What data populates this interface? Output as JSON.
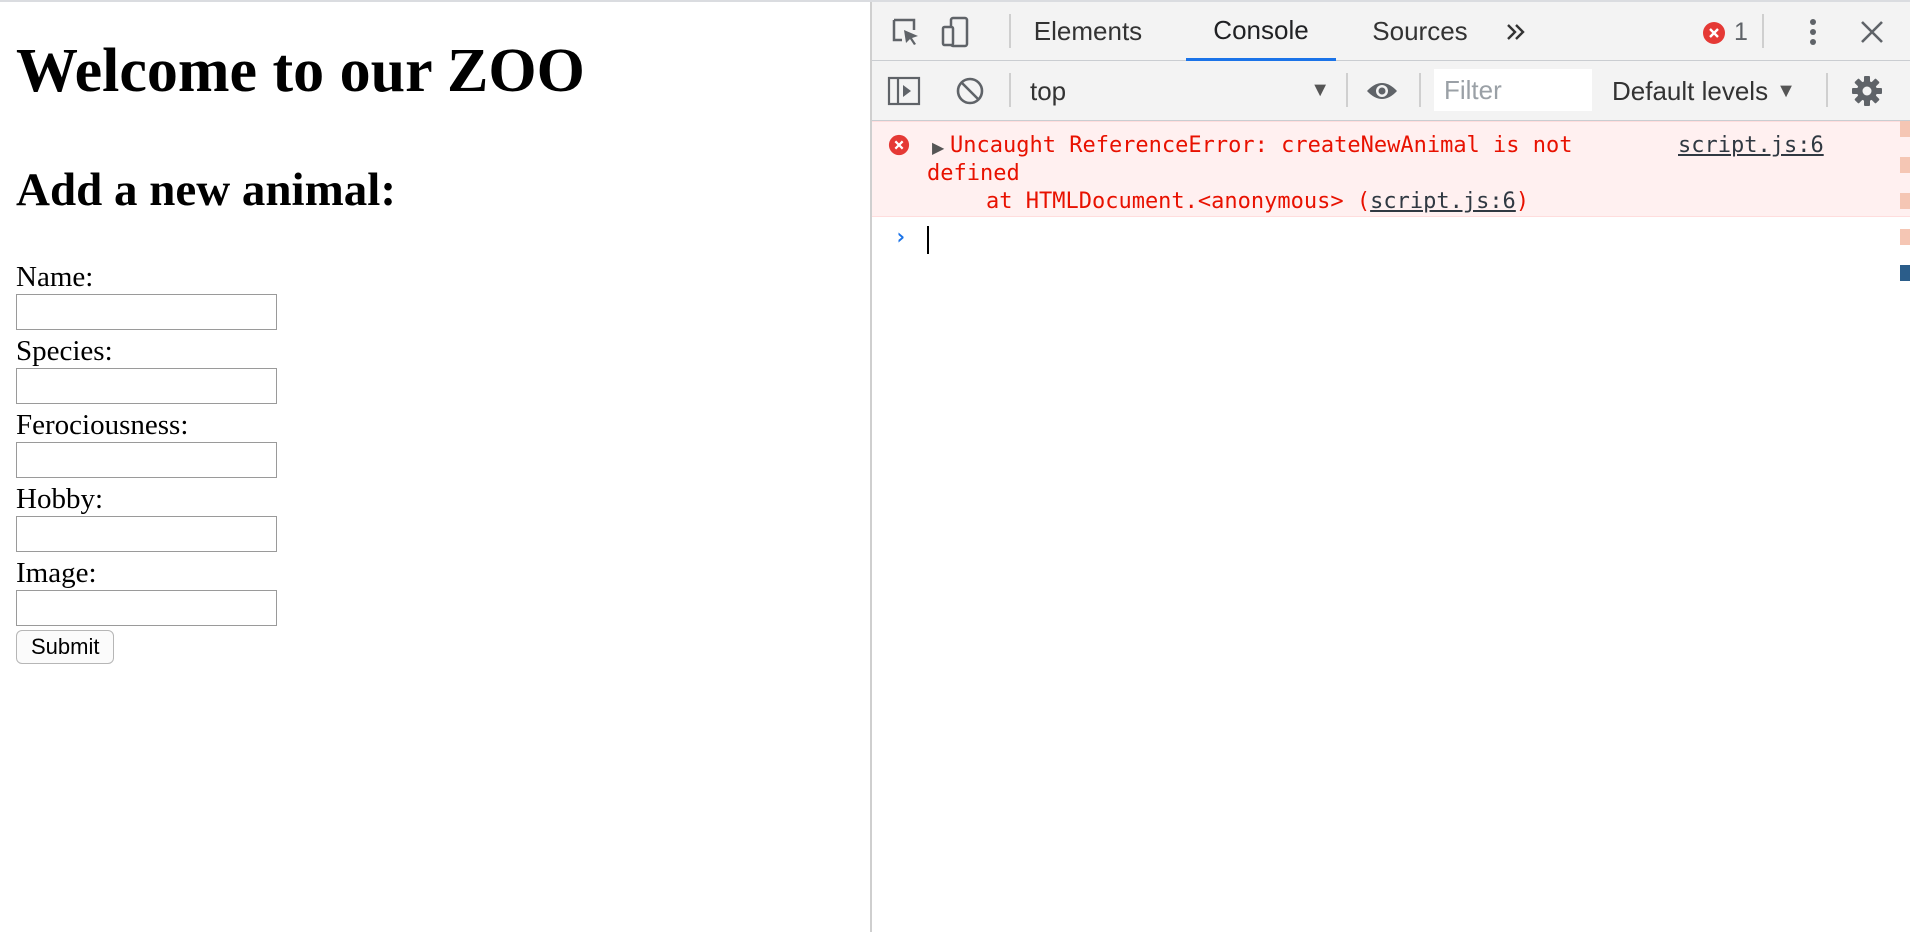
{
  "page": {
    "title": "Welcome to our ZOO",
    "subtitle": "Add a new animal:",
    "fields": [
      {
        "label": "Name:",
        "value": ""
      },
      {
        "label": "Species:",
        "value": ""
      },
      {
        "label": "Ferociousness:",
        "value": ""
      },
      {
        "label": "Hobby:",
        "value": ""
      },
      {
        "label": "Image:",
        "value": ""
      }
    ],
    "submit_label": "Submit"
  },
  "devtools": {
    "tabs": [
      "Elements",
      "Console",
      "Sources"
    ],
    "active_tab": "Console",
    "more_tabs_icon": "chevron-double-right-icon",
    "error_count": "1",
    "context": "top",
    "filter_placeholder": "Filter",
    "levels": "Default levels",
    "console": {
      "error_line1": "Uncaught ReferenceError: createNewAnimal is not",
      "error_line2": "defined",
      "error_line3_prefix": "at HTMLDocument.<anonymous> (",
      "error_line3_link": "script.js:6",
      "error_line3_suffix": ")",
      "error_source": "script.js:6",
      "prompt_symbol": "›"
    },
    "colors": {
      "accent": "#1a73e8",
      "error_text": "#e81100",
      "error_bg": "#fff0f0",
      "error_icon": "#e53935"
    }
  }
}
